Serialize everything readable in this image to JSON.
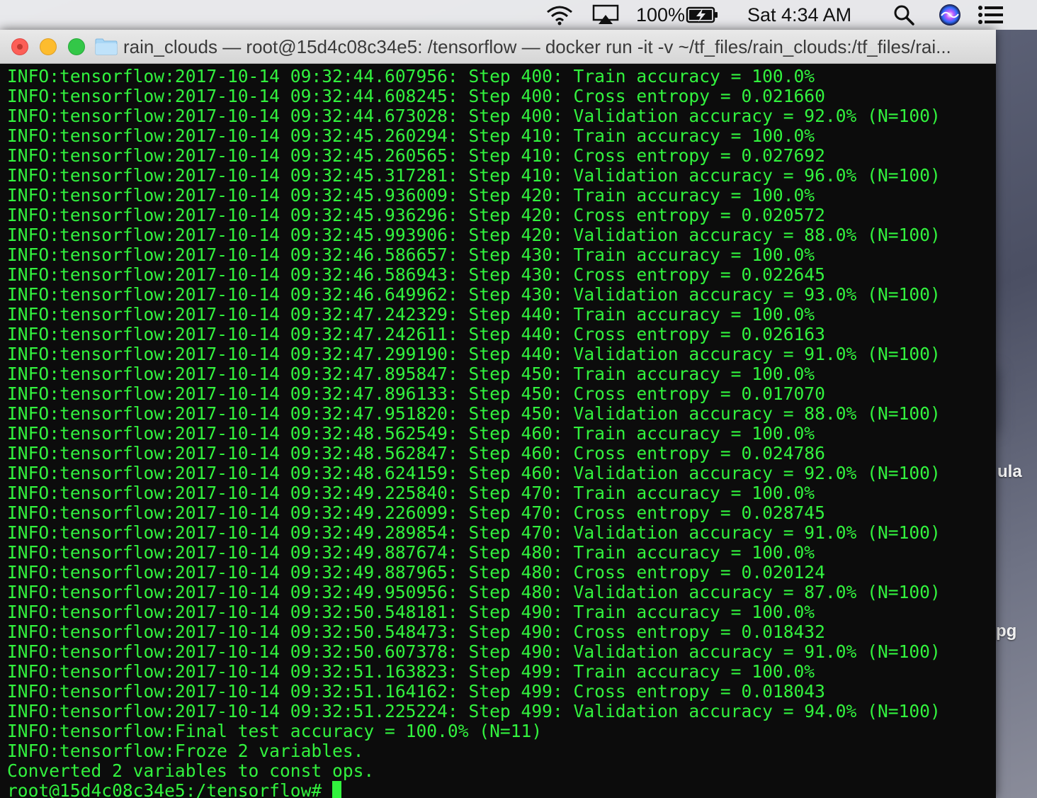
{
  "menubar": {
    "battery_percent": "100%",
    "clock": "Sat 4:34 AM"
  },
  "desktop": {
    "label_1": "ula",
    "label_2": "pg"
  },
  "window": {
    "title": "rain_clouds — root@15d4c08c34e5: /tensorflow — docker run -it -v ~/tf_files/rain_clouds:/tf_files/rai..."
  },
  "terminal": {
    "lines": [
      "INFO:tensorflow:2017-10-14 09:32:44.607956: Step 400: Train accuracy = 100.0%",
      "INFO:tensorflow:2017-10-14 09:32:44.608245: Step 400: Cross entropy = 0.021660",
      "INFO:tensorflow:2017-10-14 09:32:44.673028: Step 400: Validation accuracy = 92.0% (N=100)",
      "INFO:tensorflow:2017-10-14 09:32:45.260294: Step 410: Train accuracy = 100.0%",
      "INFO:tensorflow:2017-10-14 09:32:45.260565: Step 410: Cross entropy = 0.027692",
      "INFO:tensorflow:2017-10-14 09:32:45.317281: Step 410: Validation accuracy = 96.0% (N=100)",
      "INFO:tensorflow:2017-10-14 09:32:45.936009: Step 420: Train accuracy = 100.0%",
      "INFO:tensorflow:2017-10-14 09:32:45.936296: Step 420: Cross entropy = 0.020572",
      "INFO:tensorflow:2017-10-14 09:32:45.993906: Step 420: Validation accuracy = 88.0% (N=100)",
      "INFO:tensorflow:2017-10-14 09:32:46.586657: Step 430: Train accuracy = 100.0%",
      "INFO:tensorflow:2017-10-14 09:32:46.586943: Step 430: Cross entropy = 0.022645",
      "INFO:tensorflow:2017-10-14 09:32:46.649962: Step 430: Validation accuracy = 93.0% (N=100)",
      "INFO:tensorflow:2017-10-14 09:32:47.242329: Step 440: Train accuracy = 100.0%",
      "INFO:tensorflow:2017-10-14 09:32:47.242611: Step 440: Cross entropy = 0.026163",
      "INFO:tensorflow:2017-10-14 09:32:47.299190: Step 440: Validation accuracy = 91.0% (N=100)",
      "INFO:tensorflow:2017-10-14 09:32:47.895847: Step 450: Train accuracy = 100.0%",
      "INFO:tensorflow:2017-10-14 09:32:47.896133: Step 450: Cross entropy = 0.017070",
      "INFO:tensorflow:2017-10-14 09:32:47.951820: Step 450: Validation accuracy = 88.0% (N=100)",
      "INFO:tensorflow:2017-10-14 09:32:48.562549: Step 460: Train accuracy = 100.0%",
      "INFO:tensorflow:2017-10-14 09:32:48.562847: Step 460: Cross entropy = 0.024786",
      "INFO:tensorflow:2017-10-14 09:32:48.624159: Step 460: Validation accuracy = 92.0% (N=100)",
      "INFO:tensorflow:2017-10-14 09:32:49.225840: Step 470: Train accuracy = 100.0%",
      "INFO:tensorflow:2017-10-14 09:32:49.226099: Step 470: Cross entropy = 0.028745",
      "INFO:tensorflow:2017-10-14 09:32:49.289854: Step 470: Validation accuracy = 91.0% (N=100)",
      "INFO:tensorflow:2017-10-14 09:32:49.887674: Step 480: Train accuracy = 100.0%",
      "INFO:tensorflow:2017-10-14 09:32:49.887965: Step 480: Cross entropy = 0.020124",
      "INFO:tensorflow:2017-10-14 09:32:49.950956: Step 480: Validation accuracy = 87.0% (N=100)",
      "INFO:tensorflow:2017-10-14 09:32:50.548181: Step 490: Train accuracy = 100.0%",
      "INFO:tensorflow:2017-10-14 09:32:50.548473: Step 490: Cross entropy = 0.018432",
      "INFO:tensorflow:2017-10-14 09:32:50.607378: Step 490: Validation accuracy = 91.0% (N=100)",
      "INFO:tensorflow:2017-10-14 09:32:51.163823: Step 499: Train accuracy = 100.0%",
      "INFO:tensorflow:2017-10-14 09:32:51.164162: Step 499: Cross entropy = 0.018043",
      "INFO:tensorflow:2017-10-14 09:32:51.225224: Step 499: Validation accuracy = 94.0% (N=100)",
      "INFO:tensorflow:Final test accuracy = 100.0% (N=11)",
      "INFO:tensorflow:Froze 2 variables.",
      "Converted 2 variables to const ops."
    ],
    "prompt": "root@15d4c08c34e5:/tensorflow# "
  },
  "colors": {
    "terminal_text": "#32f23e",
    "terminal_bg": "#0c0c0c"
  }
}
